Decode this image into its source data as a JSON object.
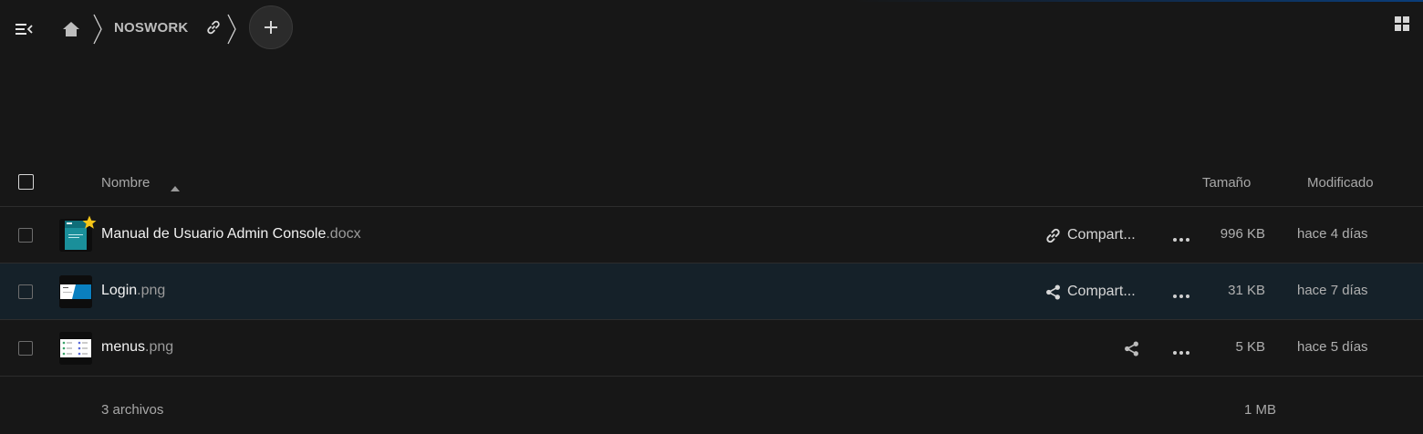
{
  "breadcrumb": {
    "folder": "NOSWORK"
  },
  "table": {
    "header": {
      "name": "Nombre",
      "size": "Tamaño",
      "modified": "Modificado"
    },
    "rows": [
      {
        "name": "Manual de Usuario Admin Console",
        "ext": ".docx",
        "share": "Compart...",
        "size": "996 KB",
        "modified": "hace 4 días",
        "favorite": true,
        "share_icon": "link-icon"
      },
      {
        "name": "Login",
        "ext": ".png",
        "share": "Compart...",
        "size": "31 KB",
        "modified": "hace 7 días",
        "favorite": false,
        "share_icon": "share-icon"
      },
      {
        "name": "menus",
        "ext": ".png",
        "share": "",
        "size": "5 KB",
        "modified": "hace 5 días",
        "favorite": false,
        "share_icon": "share-icon"
      }
    ],
    "footer": {
      "count": "3 archivos",
      "total_size": "1 MB"
    }
  },
  "colors": {
    "background": "#171717",
    "row_highlight": "#152129",
    "favorite": "#f5c518"
  }
}
